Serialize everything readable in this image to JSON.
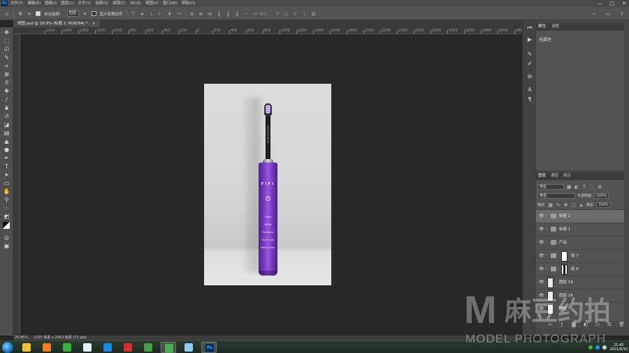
{
  "app": {
    "logo": "Ps"
  },
  "menu": [
    "文件(F)",
    "编辑(E)",
    "图像(I)",
    "图层(L)",
    "文字(Y)",
    "选择(S)",
    "滤镜(T)",
    "3D(D)",
    "视图(V)",
    "窗口(W)",
    "帮助(H)"
  ],
  "window_controls": [
    "—",
    "□",
    "✕"
  ],
  "options": {
    "auto_select_label": "自动选择：",
    "auto_select_value": "图层",
    "show_transform_label": "显示变换控件",
    "mode_3d_label": "3D 模式："
  },
  "document_tab": {
    "title": "修图.psd @ 29.9% (标题 2, RGB/8#) *",
    "close": "×"
  },
  "ruler_ticks": [
    "1800",
    "1600",
    "1400",
    "1200",
    "1000",
    "800",
    "600",
    "400",
    "200",
    "0",
    "200",
    "400",
    "600",
    "800",
    "1000",
    "1200",
    "1400",
    "1600",
    "1800",
    "2000",
    "2200",
    "2400",
    "2600",
    "2800",
    "3000",
    "3200",
    "3400",
    "3600",
    "3800",
    "4000"
  ],
  "product": {
    "brand": "FIFI",
    "power_symbol": "⏻",
    "modes": [
      "Clean",
      "White",
      "Sensitive",
      "Gum Care",
      "Deep Clean"
    ]
  },
  "properties_panel": {
    "tabs": [
      "属性",
      "调整"
    ],
    "empty_text": "无属性"
  },
  "layers_panel": {
    "tabs": [
      "图层",
      "通道",
      "路径"
    ],
    "filter_kind": "类型",
    "blend_mode": "穿透",
    "opacity_label": "不透明度:",
    "opacity_value": "100%",
    "lock_label": "锁定:",
    "fill_label": "填充:",
    "fill_value": "100%",
    "layers": [
      {
        "name": "标题 2",
        "kind": "group",
        "selected": true
      },
      {
        "name": "标题 1",
        "kind": "group",
        "selected": false
      },
      {
        "name": "产品",
        "kind": "group",
        "selected": false
      },
      {
        "name": "组 7",
        "kind": "group-mask",
        "selected": false
      },
      {
        "name": "组 6",
        "kind": "group-mask-dark",
        "selected": false
      },
      {
        "name": "图层 19",
        "kind": "layer-check",
        "selected": false
      },
      {
        "name": "图层 18",
        "kind": "layer",
        "selected": false
      },
      {
        "name": "图层",
        "kind": "layer-check",
        "selected": false
      }
    ]
  },
  "status": {
    "zoom": "29.85%",
    "doc_info": "1255 像素 x 2062 像素 (72 ppi)"
  },
  "taskbar": {
    "time": "21:45",
    "date": "2021/8/10",
    "apps": [
      {
        "name": "explorer",
        "color": "#f0c040",
        "active": false
      },
      {
        "name": "media",
        "color": "#f08020",
        "active": false
      },
      {
        "name": "360",
        "color": "#3cb043",
        "active": false
      },
      {
        "name": "baidu-netdisk",
        "color": "#e8f0ff",
        "active": false
      },
      {
        "name": "ie",
        "color": "#1e88e5",
        "active": false
      },
      {
        "name": "netease-music",
        "color": "#d32f2f",
        "active": false
      },
      {
        "name": "player",
        "color": "#43a047",
        "active": false
      },
      {
        "name": "wechat",
        "color": "#4caf50",
        "active": true
      },
      {
        "name": "camera",
        "color": "#90caf9",
        "active": false
      },
      {
        "name": "photoshop",
        "color": "#0c2e5c",
        "active": true
      }
    ]
  },
  "watermark": {
    "letter": "M",
    "chinese": "麻豆约拍",
    "english": "MODEL PHOTOGRAPH"
  }
}
